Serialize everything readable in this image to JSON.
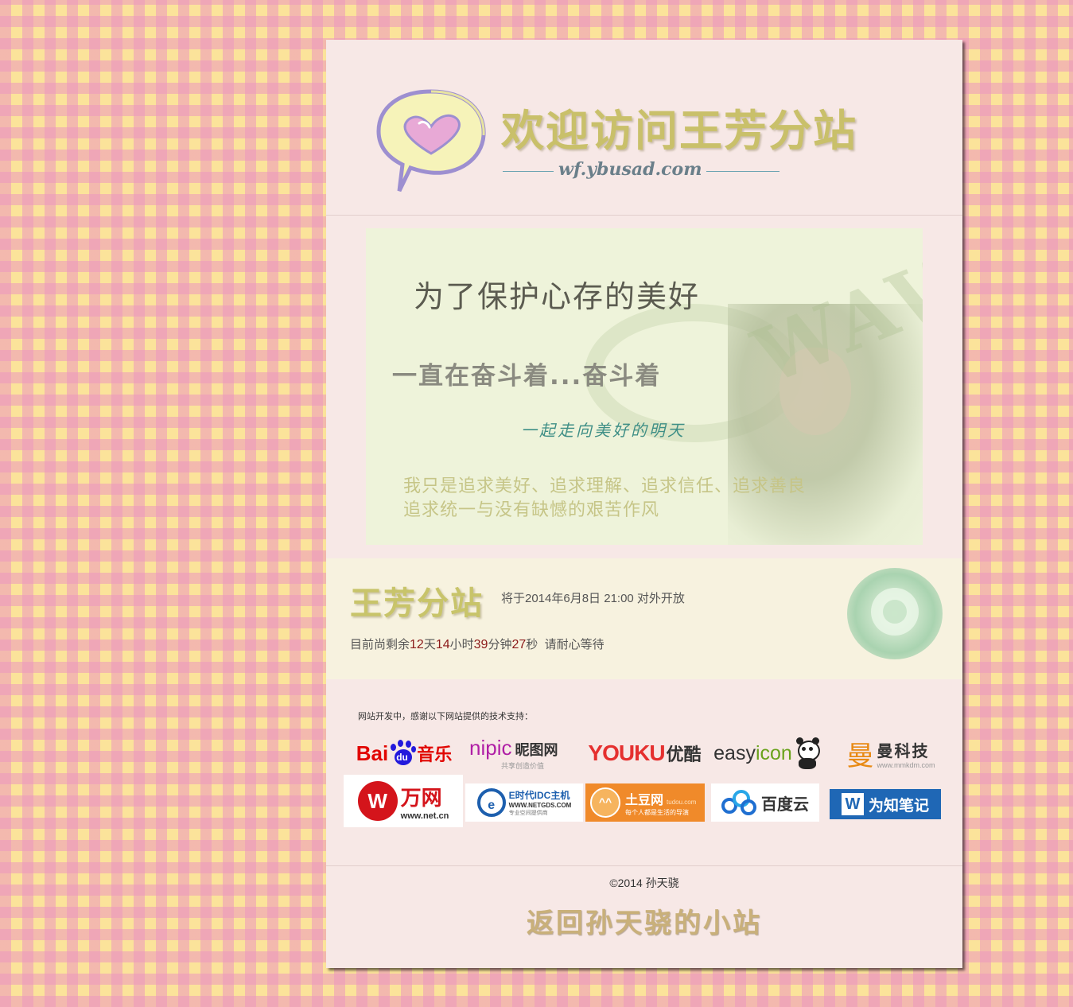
{
  "header": {
    "title": "欢迎访问王芳分站",
    "domain": "wf.ybusad.com"
  },
  "banner": {
    "line1": "为了保护心存的美好",
    "line2": "一直在奋斗着...奋斗着",
    "line3": "一起走向美好的明天",
    "line4": "我只是追求美好、追求理解、追求信任、追求善良",
    "line5": "追求统一与没有缺憾的艰苦作风",
    "watermark": "WAWF"
  },
  "countdown": {
    "site_name": "王芳分站",
    "open_text": "将于2014年6月8日 21:00 对外开放",
    "prefix": "目前尚剩余",
    "days": "12",
    "days_unit": "天",
    "hours": "14",
    "hours_unit": "小时",
    "minutes": "39",
    "minutes_unit": "分钟",
    "seconds": "27",
    "seconds_unit": "秒",
    "suffix": "请耐心等待"
  },
  "sponsors": {
    "label": "网站开发中，感谢以下网站提供的技术支持：",
    "row1": [
      {
        "name": "Baidu音乐",
        "a": "Bai",
        "b": "du",
        "c": "音乐"
      },
      {
        "name": "nipic 昵图网",
        "a": "nipic",
        "b": "昵图网",
        "c": "共享创造价值"
      },
      {
        "name": "YOUKU优酷",
        "a": "YOUKU",
        "b": "优酷"
      },
      {
        "name": "easyicon",
        "a": "easy",
        "b": "icon"
      },
      {
        "name": "曼科技",
        "a": "曼",
        "b": "曼科技",
        "c": "www.mmkdm.com"
      }
    ],
    "row2": [
      {
        "name": "万网",
        "a": "万网",
        "b": "www.net.cn"
      },
      {
        "name": "E时代IDC主机",
        "a": "E时代IDC主机",
        "b": "WWW.NETGDS.COM",
        "c": "专业空间提供商"
      },
      {
        "name": "土豆网",
        "a": "土豆网",
        "b": "tudou.com",
        "c": "每个人都是生活的导演"
      },
      {
        "name": "百度云",
        "a": "百度云"
      },
      {
        "name": "为知笔记",
        "a": "为知笔记"
      }
    ]
  },
  "footer": {
    "copyright": "©2014 孙天骁",
    "back_link": "返回孙天骁的小站"
  },
  "colors": {
    "accent_olive": "#c8c46a",
    "countdown_number": "#8b1a1a",
    "panel_bg": "#f7e8e6"
  }
}
